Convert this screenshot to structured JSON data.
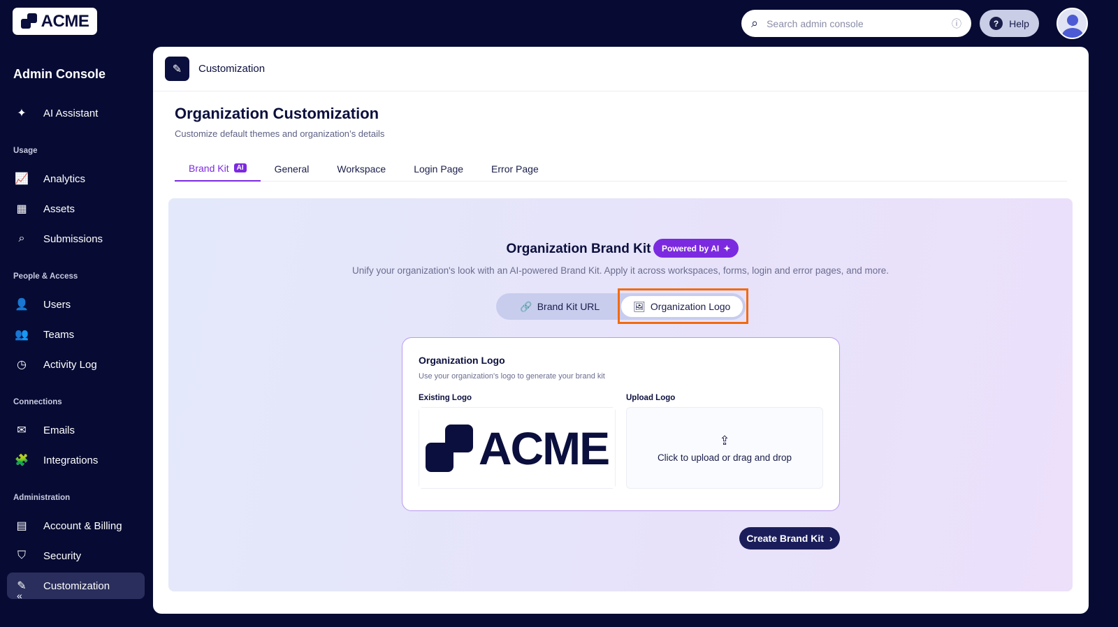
{
  "brand": "ACME",
  "sidebar": {
    "title": "Admin Console",
    "ai": "AI Assistant",
    "sections": [
      "Usage",
      "People & Access",
      "Connections",
      "Administration"
    ],
    "items": [
      "Analytics",
      "Assets",
      "Submissions",
      "Users",
      "Teams",
      "Activity Log",
      "Emails",
      "Integrations",
      "Account & Billing",
      "Security",
      "Customization"
    ]
  },
  "header": {
    "search_placeholder": "Search admin console",
    "help": "Help"
  },
  "breadcrumb": "Customization",
  "page": {
    "title": "Organization Customization",
    "subtitle": "Customize default themes and organization’s details",
    "tabs": [
      "Brand Kit",
      "General",
      "Workspace",
      "Login Page",
      "Error Page"
    ],
    "ai_badge": "AI"
  },
  "kit": {
    "title": "Organization Brand Kit",
    "badge": "Powered by AI",
    "description": "Unify your organization's look with an AI-powered Brand Kit. Apply it across workspaces, forms, login and error pages, and more.",
    "seg": [
      "Brand Kit URL",
      "Organization Logo"
    ],
    "card": {
      "title": "Organization Logo",
      "desc": "Use your organization's logo to generate your brand kit",
      "existing": "Existing Logo",
      "upload": "Upload Logo",
      "upload_hint": "Click to upload or drag and drop"
    },
    "create": "Create Brand Kit"
  }
}
